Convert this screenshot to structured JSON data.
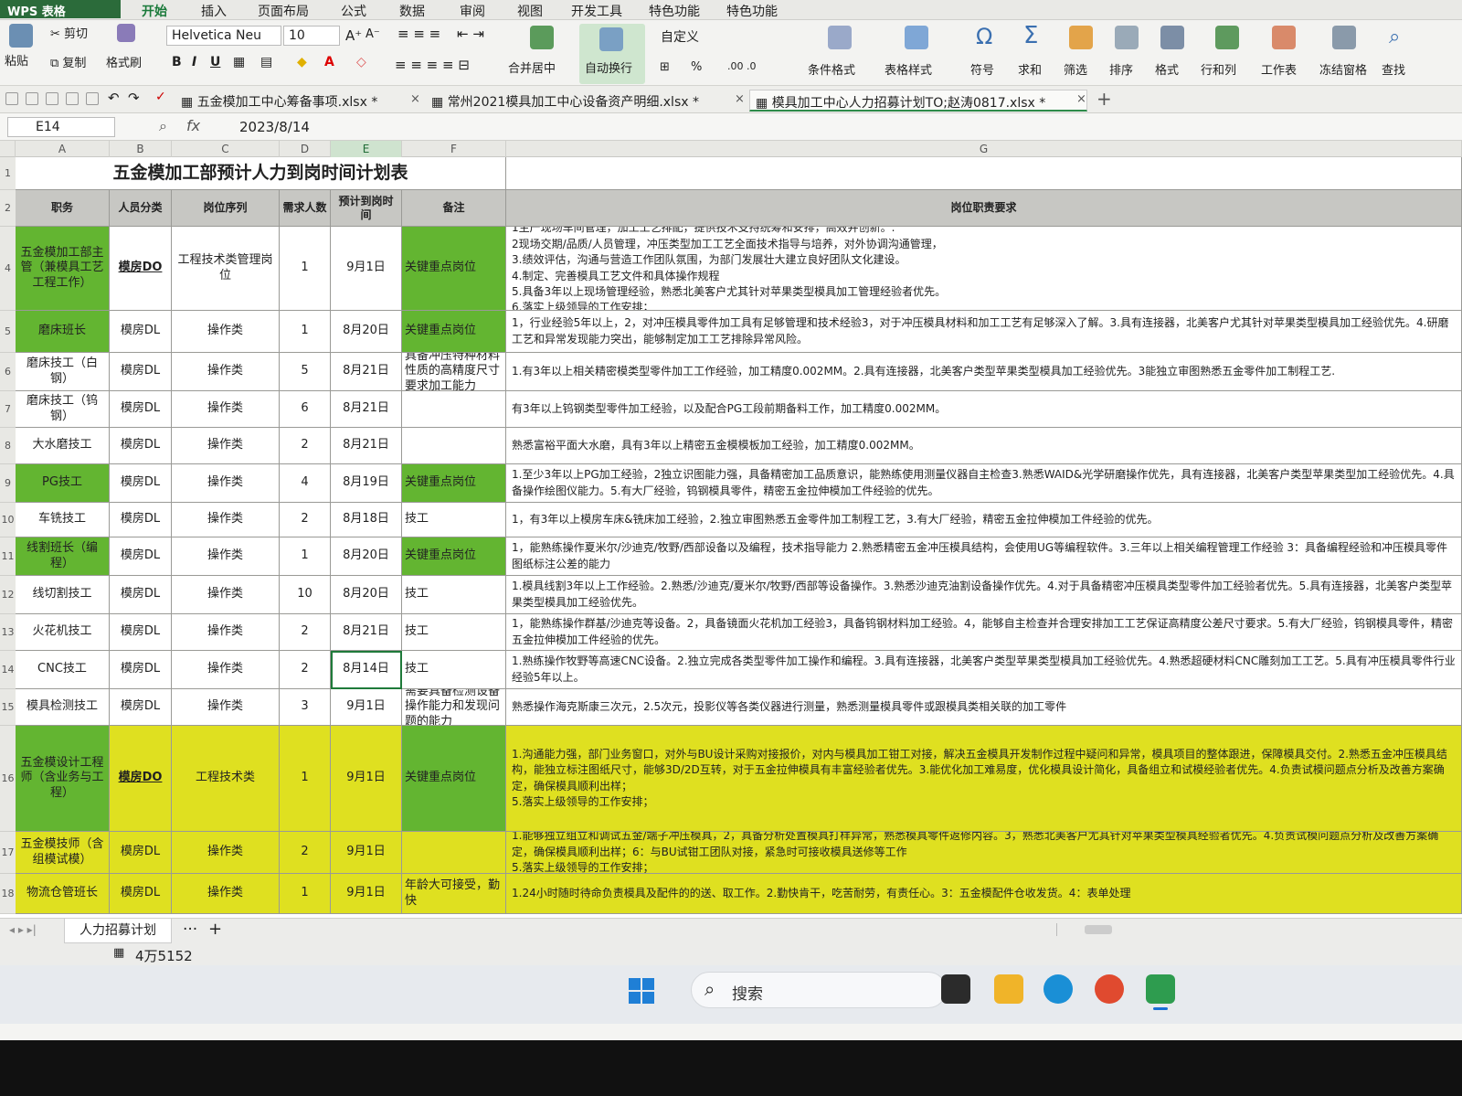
{
  "app": {
    "badge": "WPS 表格"
  },
  "menu": [
    "开始",
    "插入",
    "页面布局",
    "公式",
    "数据",
    "审阅",
    "视图",
    "开发工具",
    "特色功能",
    "特色功能"
  ],
  "ribbon": {
    "paste": "粘贴",
    "cut": "剪切",
    "copy": "复制",
    "format_painter": "格式刷",
    "font_name": "Helvetica Neu",
    "font_size": "10",
    "merge_center": "合并居中",
    "wrap_text": "自动换行",
    "number_format": "自定义",
    "percent": "%",
    "conditional_format": "条件格式",
    "table_style": "表格样式",
    "symbol": "符号",
    "sum": "求和",
    "filter": "筛选",
    "sort": "排序",
    "format": "格式",
    "row_col": "行和列",
    "worksheet": "工作表",
    "freeze": "冻结窗格",
    "find": "查找"
  },
  "doc_tabs": [
    {
      "title": "五金模加工中心筹备事项.xlsx *"
    },
    {
      "title": "常州2021模具加工中心设备资产明细.xlsx *"
    },
    {
      "title": "模具加工中心人力招募计划TO;赵涛0817.xlsx *"
    }
  ],
  "formula_bar": {
    "name_box": "E14",
    "fx": "fx",
    "value": "2023/8/14"
  },
  "columns": [
    "A",
    "B",
    "C",
    "D",
    "E",
    "F",
    "G"
  ],
  "sheet": {
    "title": "五金模加工部预计人力到岗时间计划表",
    "headers": [
      "职务",
      "人员分类",
      "岗位序列",
      "需求人数",
      "预计到岗时间",
      "备注",
      "岗位职责要求"
    ],
    "rows": [
      {
        "num": "4",
        "job": "五金模加工部主管（兼模具工艺工程工作）",
        "cat": "模房DO",
        "seq": "工程技术类管理岗位",
        "count": "1",
        "date": "9月1日",
        "note": "关键重点岗位",
        "req": "1生产现场车间管理，加工工艺排配，提供技术支持统筹和安排，高效并创新。.\n2现场交期/品质/人员管理，冲压类型加工工艺全面技术指导与培养，对外协调沟通管理，\n3.绩效评估，沟通与营造工作团队氛围，为部门发展壮大建立良好团队文化建设。\n4.制定、完善模具工艺文件和具体操作规程\n5.具备3年以上现场管理经验，熟悉北美客户尤其针对苹果类型模具加工管理经验者优先。\n6.落实上级领导的工作安排；"
      },
      {
        "num": "5",
        "job": "磨床班长",
        "cat": "模房DL",
        "seq": "操作类",
        "count": "1",
        "date": "8月20日",
        "note": "关键重点岗位",
        "req": "1，行业经验5年以上，2，对冲压模具零件加工具有足够管理和技术经验3，对于冲压模具材料和加工工艺有足够深入了解。3.具有连接器，北美客户尤其针对苹果类型模具加工经验优先。4.研磨工艺和异常发现能力突出，能够制定加工工艺排除异常风险。"
      },
      {
        "num": "6",
        "job": "磨床技工（白钢）",
        "cat": "模房DL",
        "seq": "操作类",
        "count": "5",
        "date": "8月21日",
        "note": "具备冲压特种材料性质的高精度尺寸要求加工能力",
        "req": "1.有3年以上相关精密模类型零件加工工作经验，加工精度0.002MM。2.具有连接器，北美客户类型苹果类型模具加工经验优先。3能独立审图熟悉五金零件加工制程工艺."
      },
      {
        "num": "7",
        "job": "磨床技工（钨钢）",
        "cat": "模房DL",
        "seq": "操作类",
        "count": "6",
        "date": "8月21日",
        "note": "",
        "req": "有3年以上钨钢类型零件加工经验，以及配合PG工段前期备料工作，加工精度0.002MM。"
      },
      {
        "num": "8",
        "job": "大水磨技工",
        "cat": "模房DL",
        "seq": "操作类",
        "count": "2",
        "date": "8月21日",
        "note": "",
        "req": "熟悉富裕平面大水磨，具有3年以上精密五金模模板加工经验，加工精度0.002MM。"
      },
      {
        "num": "9",
        "job": "PG技工",
        "cat": "模房DL",
        "seq": "操作类",
        "count": "4",
        "date": "8月19日",
        "note": "关键重点岗位",
        "req": "1.至少3年以上PG加工经验，2独立识图能力强，具备精密加工品质意识，能熟练使用测量仪器自主检查3.熟悉WAID&光学研磨操作优先，具有连接器，北美客户类型苹果类型加工经验优先。4.具备操作绘图仪能力。5.有大厂经验，钨钢模具零件，精密五金拉伸模加工件经验的优先。"
      },
      {
        "num": "10",
        "job": "车铣技工",
        "cat": "模房DL",
        "seq": "操作类",
        "count": "2",
        "date": "8月18日",
        "note": "技工",
        "req": "1，有3年以上模房车床&铣床加工经验，2.独立审图熟悉五金零件加工制程工艺，3.有大厂经验，精密五金拉伸模加工件经验的优先。"
      },
      {
        "num": "11",
        "job": "线割班长（编程）",
        "cat": "模房DL",
        "seq": "操作类",
        "count": "1",
        "date": "8月20日",
        "note": "关键重点岗位",
        "req": "1，能熟练操作夏米尔/沙迪克/牧野/西部设备以及编程，技术指导能力  2.熟悉精密五金冲压模具结构，会使用UG等编程软件。3.三年以上相关编程管理工作经验  3：具备编程经验和冲压模具零件图纸标注公差的能力"
      },
      {
        "num": "12",
        "job": "线切割技工",
        "cat": "模房DL",
        "seq": "操作类",
        "count": "10",
        "date": "8月20日",
        "note": "技工",
        "req": "1.模具线割3年以上工作经验。2.熟悉/沙迪克/夏米尔/牧野/西部等设备操作。3.熟悉沙迪克油割设备操作优先。4.对于具备精密冲压模具类型零件加工经验者优先。5.具有连接器，北美客户类型苹果类型模具加工经验优先。"
      },
      {
        "num": "13",
        "job": "火花机技工",
        "cat": "模房DL",
        "seq": "操作类",
        "count": "2",
        "date": "8月21日",
        "note": "技工",
        "req": "1，能熟练操作群基/沙迪克等设备。2，具备镜面火花机加工经验3，具备钨钢材料加工经验。4，能够自主检查并合理安排加工工艺保证高精度公差尺寸要求。5.有大厂经验，钨钢模具零件，精密五金拉伸模加工件经验的优先。"
      },
      {
        "num": "14",
        "job": "CNC技工",
        "cat": "模房DL",
        "seq": "操作类",
        "count": "2",
        "date": "8月14日",
        "note": "技工",
        "req": "1.熟练操作牧野等高速CNC设备。2.独立完成各类型零件加工操作和编程。3.具有连接器，北美客户类型苹果类型模具加工经验优先。4.熟悉超硬材料CNC雕刻加工工艺。5.具有冲压模具零件行业经验5年以上。"
      },
      {
        "num": "15",
        "job": "模具检测技工",
        "cat": "模房DL",
        "seq": "操作类",
        "count": "3",
        "date": "9月1日",
        "note": "需要具备检测设备操作能力和发现问题的能力",
        "req": "熟悉操作海克斯康三次元，2.5次元，投影仪等各类仪器进行测量，熟悉测量模具零件或跟模具类相关联的加工零件"
      },
      {
        "num": "16",
        "job": "五金模设计工程师（含业务与工程）",
        "cat": "模房DO",
        "seq": "工程技术类",
        "count": "1",
        "date": "9月1日",
        "note": "关键重点岗位",
        "req": "1.沟通能力强，部门业务窗口，对外与BU设计采购对接报价，对内与模具加工钳工对接，解决五金模具开发制作过程中疑问和异常，模具项目的整体跟进，保障模具交付。2.熟悉五金冲压模具结构，能独立标注图纸尺寸，能够3D/2D互转，对于五金拉伸模具有丰富经验者优先。3.能优化加工难易度，优化模具设计简化，具备组立和试模经验者优先。4.负责试模问题点分析及改善方案确定，确保模具顺利出样；\n5.落实上级领导的工作安排；"
      },
      {
        "num": "17",
        "job": "五金模技师（含组模试模）",
        "cat": "模房DL",
        "seq": "操作类",
        "count": "2",
        "date": "9月1日",
        "note": "",
        "req": "1.能够独立组立和调试五金/端子冲压模具，2，具备分析处置模具打样异常，熟悉模具零件返修内容。3，熟悉北美客户尤其针对苹果类型模具经验者优先。4.负责试模问题点分析及改善方案确定，确保模具顺利出样；6：与BU试钳工团队对接，紧急时可接收模具送修等工作\n5.落实上级领导的工作安排；"
      },
      {
        "num": "18",
        "job": "物流仓管班长",
        "cat": "模房DL",
        "seq": "操作类",
        "count": "1",
        "date": "9月1日",
        "note": "年龄大可接受，勤快",
        "req": "1.24小时随时待命负责模具及配件的的送、取工作。2.勤快肯干，吃苦耐劳，有责任心。3：五金模配件仓收发货。4：表单处理"
      }
    ]
  },
  "sheet_tab": "人力招募计划",
  "status": {
    "value": "4万5152"
  },
  "taskbar": {
    "search": "搜索"
  }
}
